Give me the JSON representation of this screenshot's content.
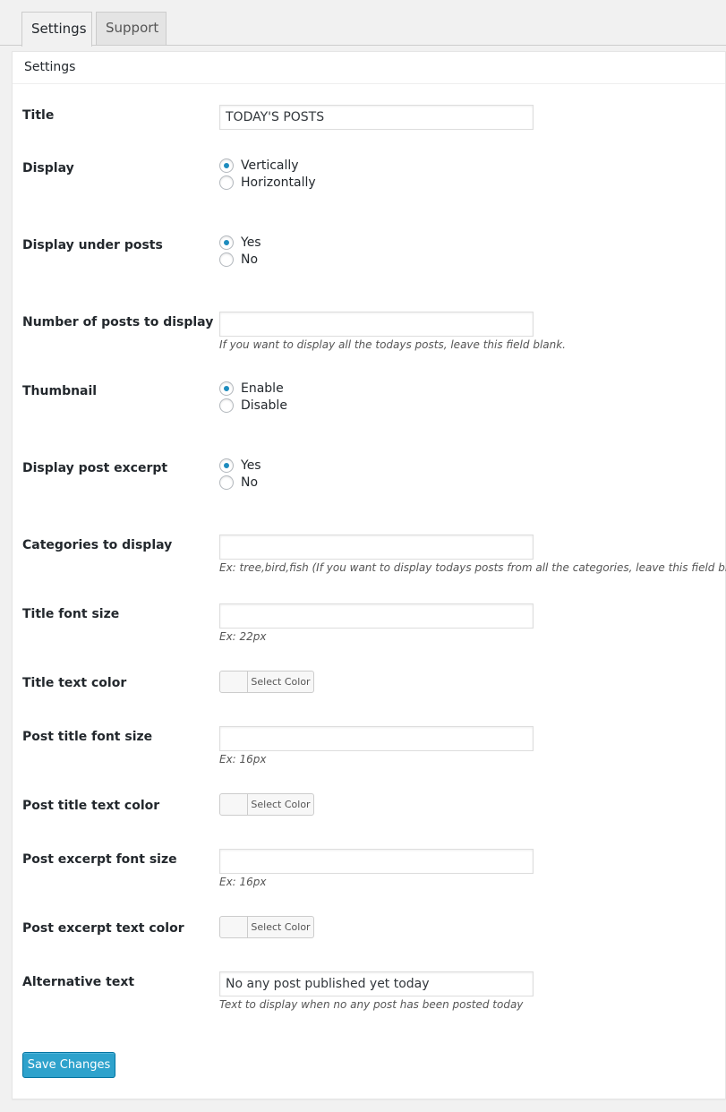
{
  "tabs": [
    {
      "label": "Settings",
      "active": true
    },
    {
      "label": "Support",
      "active": false
    }
  ],
  "panel_title": "Settings",
  "fields": {
    "title": {
      "label": "Title",
      "value": "TODAY'S POSTS"
    },
    "display": {
      "label": "Display",
      "options": [
        "Vertically",
        "Horizontally"
      ],
      "selected": "Vertically"
    },
    "display_under_posts": {
      "label": "Display under posts",
      "options": [
        "Yes",
        "No"
      ],
      "selected": "Yes"
    },
    "num_posts": {
      "label": "Number of posts to display",
      "value": "",
      "hint": "If you want to display all the todays posts, leave this field blank."
    },
    "thumbnail": {
      "label": "Thumbnail",
      "options": [
        "Enable",
        "Disable"
      ],
      "selected": "Enable"
    },
    "display_excerpt": {
      "label": "Display post excerpt",
      "options": [
        "Yes",
        "No"
      ],
      "selected": "Yes"
    },
    "categories": {
      "label": "Categories to display",
      "value": "",
      "hint": "Ex: tree,bird,fish (If you want to display todays posts from all the categories, leave this field blank)"
    },
    "title_font_size": {
      "label": "Title font size",
      "value": "",
      "hint": "Ex: 22px"
    },
    "title_text_color": {
      "label": "Title text color",
      "button": "Select Color"
    },
    "post_title_font_size": {
      "label": "Post title font size",
      "value": "",
      "hint": "Ex: 16px"
    },
    "post_title_text_color": {
      "label": "Post title text color",
      "button": "Select Color"
    },
    "post_excerpt_font_size": {
      "label": "Post excerpt font size",
      "value": "",
      "hint": "Ex: 16px"
    },
    "post_excerpt_text_color": {
      "label": "Post excerpt text color",
      "button": "Select Color"
    },
    "alternative_text": {
      "label": "Alternative text",
      "value": "No any post published yet today",
      "hint": "Text to display when no any post has been posted today"
    }
  },
  "save_label": "Save Changes",
  "colors": {
    "accent": "#2ea2cc",
    "radio_dot": "#1e8cbe",
    "panel_bg": "#ffffff",
    "page_bg": "#f1f1f1"
  }
}
